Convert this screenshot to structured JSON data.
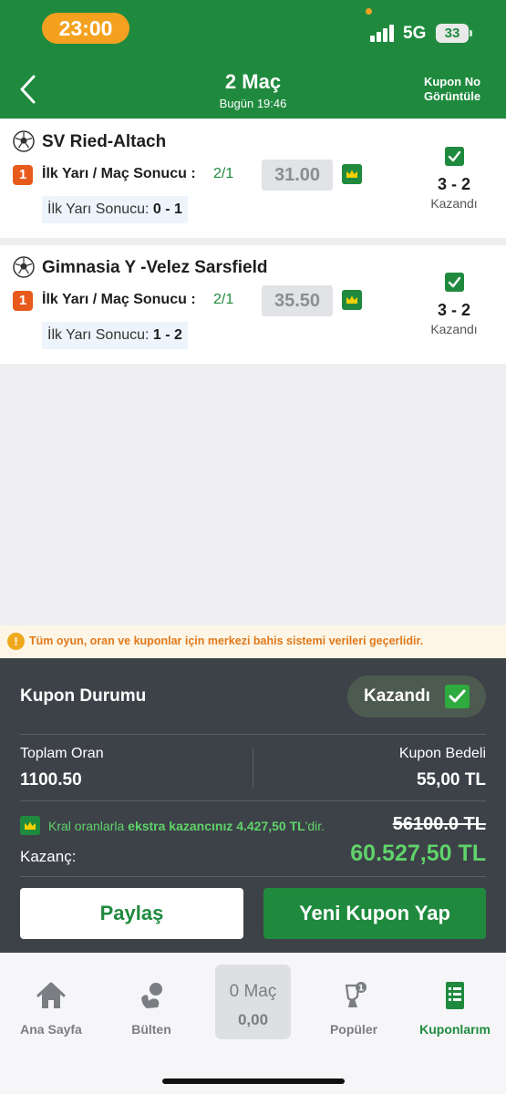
{
  "status_bar": {
    "time": "23:00",
    "network": "5G",
    "battery": "33"
  },
  "header": {
    "title": "2 Maç",
    "subtitle": "Bugün 19:46",
    "right_action": "Kupon No Görüntüle"
  },
  "bets": [
    {
      "team": "SV Ried-Altach",
      "badge": "1",
      "market": "İlk Yarı / Maç Sonucu :",
      "pick": "2/1",
      "odd": "31.00",
      "ht_label": "İlk Yarı Sonucu:",
      "ht_score": "0 - 1",
      "score": "3 - 2",
      "result": "Kazandı"
    },
    {
      "team": "Gimnasia Y -Velez Sarsfield",
      "badge": "1",
      "market": "İlk Yarı / Maç Sonucu :",
      "pick": "2/1",
      "odd": "35.50",
      "ht_label": "İlk Yarı Sonucu:",
      "ht_score": "1 - 2",
      "score": "3 - 2",
      "result": "Kazandı"
    }
  ],
  "info_notice": "Tüm oyun, oran ve kuponlar için merkezi bahis sistemi verileri geçerlidir.",
  "summary": {
    "status_label": "Kupon Durumu",
    "status_value": "Kazandı",
    "total_odds_label": "Toplam Oran",
    "total_odds_value": "1100.50",
    "stake_label": "Kupon Bedeli",
    "stake_value": "55,00 TL",
    "kral_prefix": "Kral oranlarla ",
    "kral_bold": "ekstra kazancınız 4.427,50 TL",
    "kral_suffix": "'dir.",
    "old_winnings": "56100.0 TL",
    "winnings_label": "Kazanç:",
    "winnings_value": "60.527,50 TL",
    "share_button": "Paylaş",
    "new_coupon_button": "Yeni Kupon Yap"
  },
  "bottom_nav": {
    "home": "Ana Sayfa",
    "bulletin": "Bülten",
    "coupon_count": "0 Maç",
    "coupon_total": "0,00",
    "popular": "Popüler",
    "my_coupons": "Kuponlarım"
  },
  "colors": {
    "brand_green": "#1f8a3e",
    "win_green": "#5fd36a",
    "panel_dark": "#3d4248",
    "status_orange": "#f4a11f",
    "badge_orange": "#e85a1c"
  }
}
